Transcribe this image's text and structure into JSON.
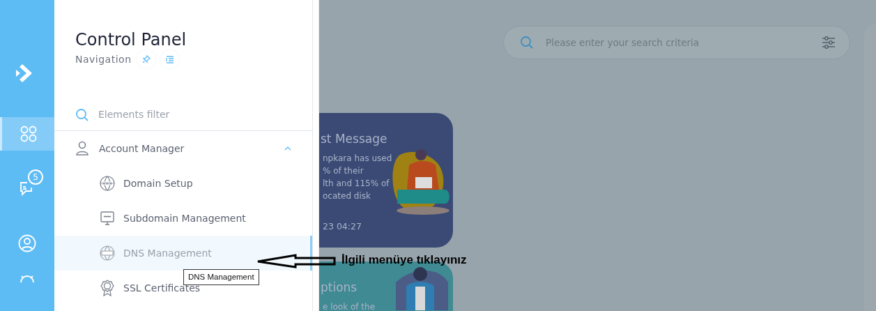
{
  "rail": {
    "items": [
      {
        "selected": true
      },
      {
        "badge": "5",
        "selected": false
      },
      {
        "selected": false
      },
      {
        "selected": false
      }
    ]
  },
  "panel": {
    "title": "Control Panel",
    "subtitle": "Navigation",
    "filter": {
      "placeholder": "Elements filter"
    },
    "groups": [
      {
        "label": "Account Manager",
        "expanded": true,
        "children": [
          {
            "label": "Domain Setup",
            "hovered": false
          },
          {
            "label": "Subdomain Management",
            "hovered": false
          },
          {
            "label": "DNS Management",
            "hovered": true
          },
          {
            "label": "SSL Certificates",
            "hovered": false
          }
        ]
      }
    ]
  },
  "tooltip": "DNS Management",
  "search": {
    "placeholder": "Please enter your search criteria"
  },
  "cards": [
    {
      "title": "st Message",
      "lines": [
        "npkara has used",
        "% of their",
        "lth and 115% of",
        "ocated disk"
      ],
      "time": "23 04:27",
      "color": "#3a4a75"
    },
    {
      "title": "ptions",
      "lines": [
        "e look of the"
      ],
      "color": "#3f8a93"
    }
  ],
  "annotation": "İlgili menüye tıklayınız"
}
